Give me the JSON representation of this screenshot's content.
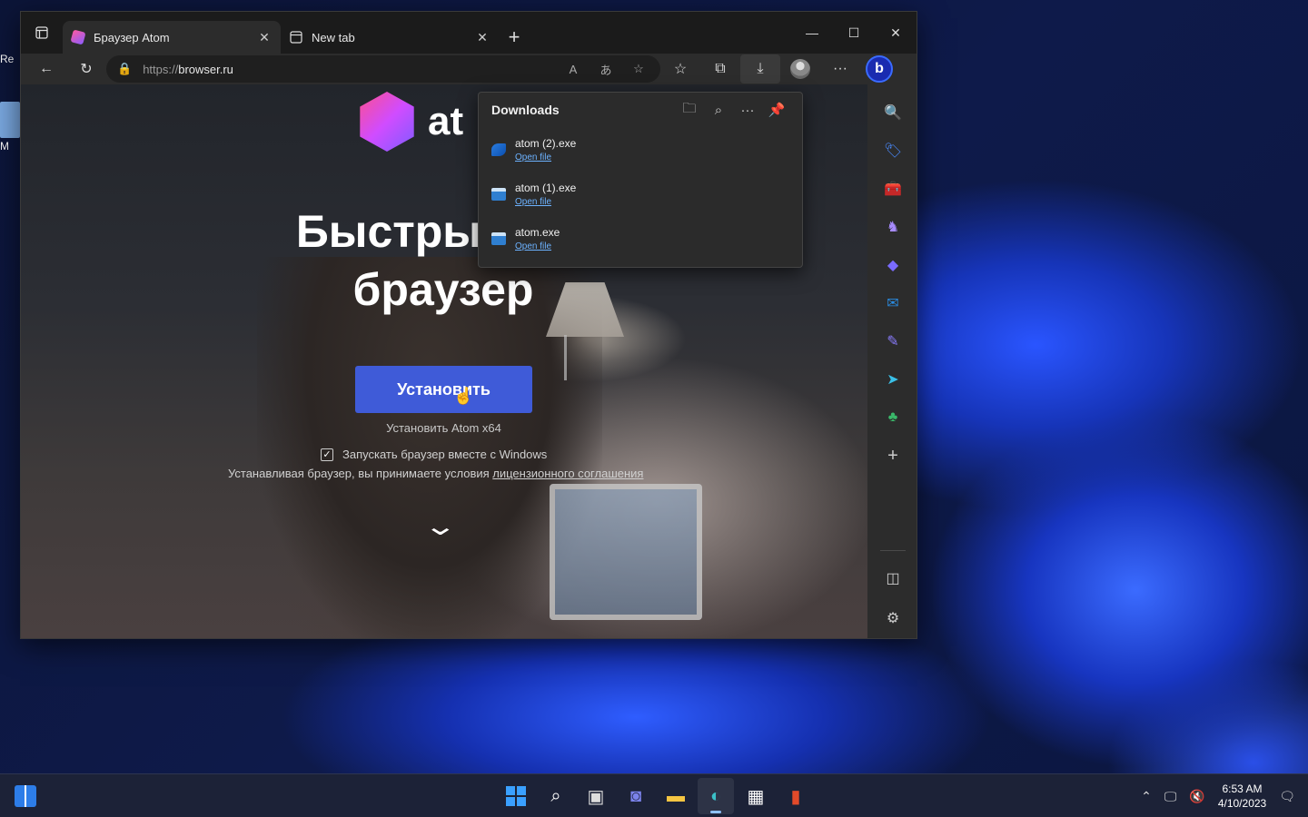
{
  "desktop": {
    "icons": [
      {
        "label": "Re"
      },
      {
        "label": "M"
      }
    ]
  },
  "browser": {
    "tabs": [
      {
        "title": "Браузер Atom",
        "active": true,
        "icon": "atom-favicon"
      },
      {
        "title": "New tab",
        "active": false,
        "icon": "newtab-icon"
      }
    ],
    "address": {
      "protocol": "https://",
      "host": "browser.ru"
    },
    "window_controls": {
      "minimize": "—",
      "maximize": "☐",
      "close": "✕"
    }
  },
  "page": {
    "logo_text": "at",
    "hero_line1": "Быстрый и б",
    "hero_line2": "браузер",
    "install_button": "Установить",
    "install_subtitle": "Установить Atom x64",
    "autostart_label": "Запускать браузер вместе с Windows",
    "autostart_checked": true,
    "license_text": "Устанавливая браузер, вы принимаете условия ",
    "license_link": "лицензионного соглашения"
  },
  "downloads": {
    "title": "Downloads",
    "items": [
      {
        "name": "atom (2).exe",
        "action": "Open file"
      },
      {
        "name": "atom (1).exe",
        "action": "Open file"
      },
      {
        "name": "atom.exe",
        "action": "Open file"
      }
    ]
  },
  "sidebar": {
    "items": [
      "search",
      "shopping",
      "tools",
      "games",
      "microsoft-365",
      "outlook",
      "drop",
      "telegram",
      "tree",
      "add"
    ]
  },
  "taskbar": {
    "time": "6:53 AM",
    "date": "4/10/2023"
  },
  "colors": {
    "accent": "#3f5bd8",
    "link": "#6cb2ff",
    "browser_bg": "#2c2c2c"
  }
}
